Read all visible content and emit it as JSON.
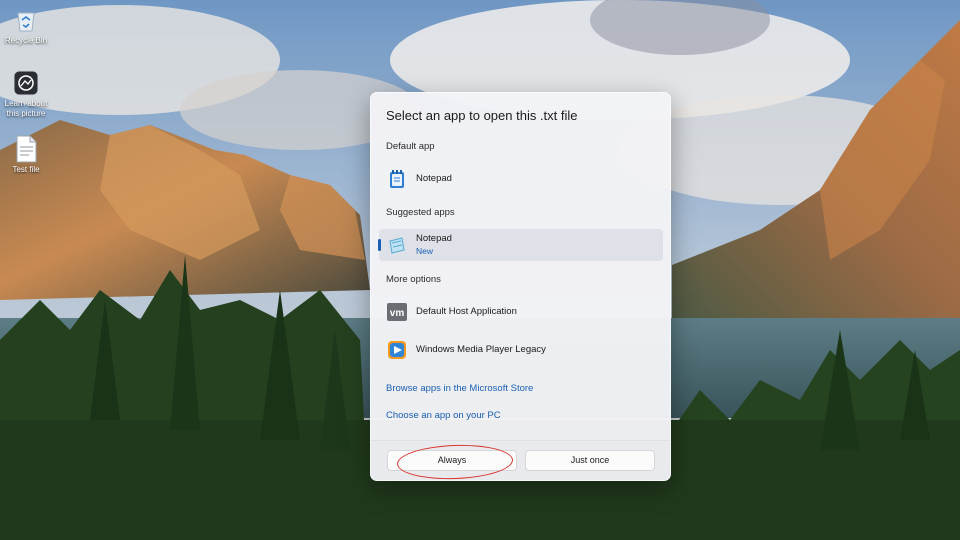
{
  "desktop": {
    "icons": [
      {
        "label": "Recycle Bin",
        "icon": "recycle-bin-icon"
      },
      {
        "label": "Learn about this picture",
        "icon": "learn-about-picture-icon"
      },
      {
        "label": "Test file",
        "icon": "text-file-icon"
      }
    ]
  },
  "dialog": {
    "title": "Select an app to open this .txt file",
    "default_section": "Default app",
    "default_app": {
      "name": "Notepad",
      "icon": "notepad-icon"
    },
    "suggested_section": "Suggested apps",
    "suggested_app": {
      "name": "Notepad",
      "badge": "New",
      "icon": "notepad-new-icon"
    },
    "more_section": "More options",
    "more_apps": [
      {
        "name": "Default Host Application",
        "icon": "vmware-icon"
      },
      {
        "name": "Windows Media Player Legacy",
        "icon": "media-player-icon"
      }
    ],
    "links": {
      "store": "Browse apps in the Microsoft Store",
      "pc": "Choose an app on your PC"
    },
    "buttons": {
      "always": "Always",
      "just_once": "Just once"
    }
  },
  "colors": {
    "accent": "#1a5fb4",
    "annotation": "#d9342b"
  }
}
